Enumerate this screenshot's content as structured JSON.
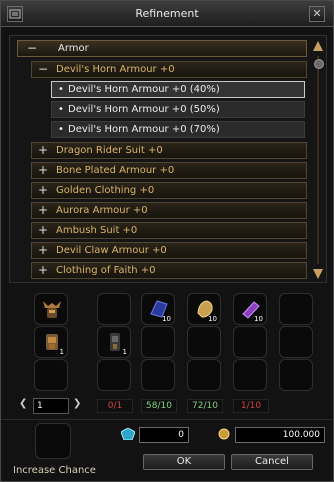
{
  "window": {
    "title": "Refinement"
  },
  "list": {
    "group": "Armor",
    "rows": [
      {
        "label": "Devil's Horn Armour +0",
        "kind": "sub",
        "expanded": true
      },
      {
        "label": "Devil's Horn Armour +0 (40%)",
        "kind": "leaf",
        "selected": true
      },
      {
        "label": "Devil's Horn Armour +0 (50%)",
        "kind": "leaf"
      },
      {
        "label": "Devil's Horn Armour +0 (70%)",
        "kind": "leaf"
      },
      {
        "label": "Dragon Rider Suit +0",
        "kind": "sub"
      },
      {
        "label": "Bone Plated Armour +0",
        "kind": "sub"
      },
      {
        "label": "Golden Clothing +0",
        "kind": "sub"
      },
      {
        "label": "Aurora Armour +0",
        "kind": "sub"
      },
      {
        "label": "Ambush Suit +0",
        "kind": "sub"
      },
      {
        "label": "Devil Claw Armour +0",
        "kind": "sub"
      },
      {
        "label": "Clothing of Faith +0",
        "kind": "sub"
      }
    ]
  },
  "result": {
    "qty": "1"
  },
  "materials": [
    {
      "name": "devil's-horn-armour",
      "qty": "1",
      "ratio": "0/1",
      "ratio_color": "#d04040"
    },
    {
      "name": "blue-cloth",
      "qty": "10",
      "ratio": "58/10",
      "ratio_color": "#7fd07f"
    },
    {
      "name": "golden-leather",
      "qty": "10",
      "ratio": "72/10",
      "ratio_color": "#7fd07f"
    },
    {
      "name": "purple-scroll",
      "qty": "10",
      "ratio": "1/10",
      "ratio_color": "#d04040"
    }
  ],
  "pager": {
    "page": "1"
  },
  "chance": {
    "gem_count": "0",
    "gold": "100.000",
    "label": "Increase Chance"
  },
  "buttons": {
    "ok": "OK",
    "cancel": "Cancel"
  },
  "glyphs": {
    "minus": "−",
    "plus": "+",
    "dot": "•",
    "prev": "❮",
    "next": "❯",
    "close": "✕"
  }
}
